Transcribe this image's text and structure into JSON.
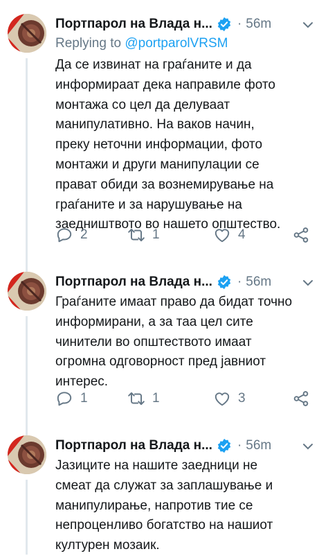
{
  "colors": {
    "accent": "#1da1f2",
    "muted": "#657786",
    "text": "#14171a",
    "line": "#e1e8ed"
  },
  "tweets": [
    {
      "author": "Портпарол на Влада н...",
      "time": "56m",
      "reply_prefix": "Replying to",
      "reply_handle": "@portparolVRSM",
      "text_lines": [
        "Да се извинат на граѓаните и да",
        "информираат дека направиле фото",
        "монтажа со цел да делуваат",
        "манипулативно. На ваков начин,",
        "преку неточни информации, фото",
        "монтажи и други манипулации се",
        "прават обиди за вознемирување на",
        "граѓаните и за нарушување на",
        "заедништвото во нашето општество."
      ],
      "replies": "2",
      "retweets": "1",
      "likes": "4"
    },
    {
      "author": "Портпарол на Влада н...",
      "time": "56m",
      "text_lines": [
        "Граѓаните имаат право да бидат точно",
        "информирани, а за таа цел сите",
        "чинители во општеството имаат",
        "огромна одговорност пред јавниот",
        "интерес."
      ],
      "replies": "1",
      "retweets": "1",
      "likes": "3"
    },
    {
      "author": "Портпарол на Влада н...",
      "time": "56m",
      "text_lines": [
        "Јазиците на нашите заедници не",
        "смеат да служат за заплашување и",
        "манипулирање, напротив тие се",
        "непроценливо богатство на нашиот",
        "културен мозаик."
      ]
    }
  ],
  "icons": [
    "verified-badge-icon",
    "chevron-down-icon",
    "reply-icon",
    "retweet-icon",
    "heart-icon",
    "share-icon"
  ]
}
